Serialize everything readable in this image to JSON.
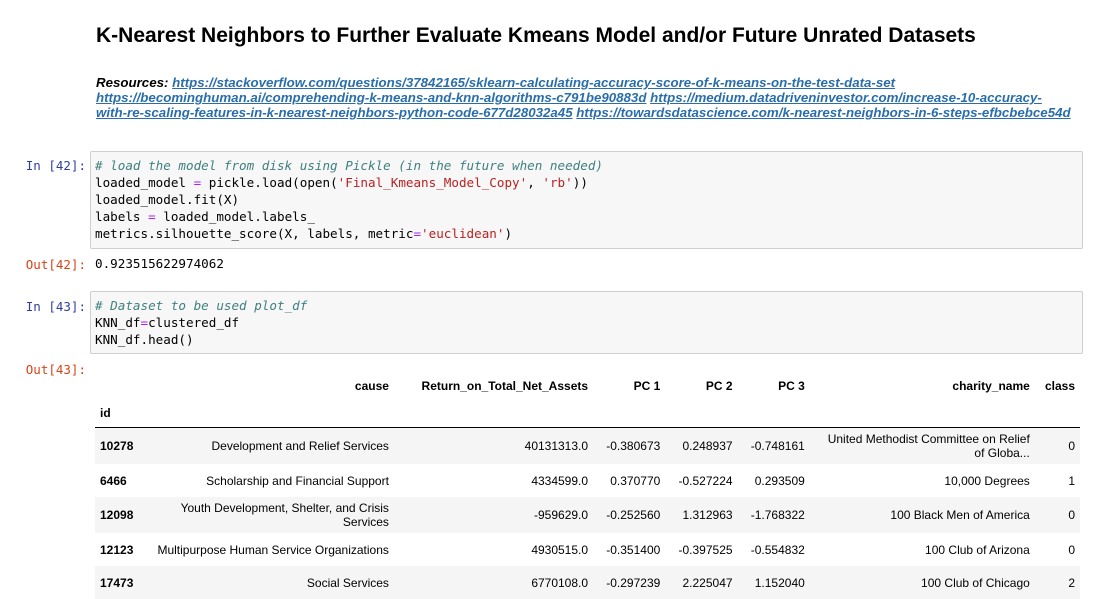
{
  "heading": "K-Nearest Neighbors to Further Evaluate Kmeans Model and/or Future Unrated Datasets",
  "resources": {
    "label": "Resources:",
    "links": [
      "https://stackoverflow.com/questions/37842165/sklearn-calculating-accuracy-score-of-k-means-on-the-test-data-set",
      "https://becominghuman.ai/comprehending-k-means-and-knn-algorithms-c791be90883d",
      "https://medium.datadriveninvestor.com/increase-10-accuracy-with-re-scaling-features-in-k-nearest-neighbors-python-code-677d28032a45",
      "https://towardsdatascience.com/k-nearest-neighbors-in-6-steps-efbcbebce54d"
    ]
  },
  "cell42": {
    "in_prompt": "In [42]:",
    "out_prompt": "Out[42]:",
    "output": "0.923515622974062",
    "lines": [
      [
        [
          "# load the model from disk using Pickle (in the future when needed)",
          "c"
        ]
      ],
      [
        [
          "loaded_model ",
          ""
        ],
        [
          "=",
          "o"
        ],
        [
          " pickle.load(open(",
          ""
        ],
        [
          "'Final_Kmeans_Model_Copy'",
          "s"
        ],
        [
          ", ",
          ""
        ],
        [
          "'rb'",
          "s"
        ],
        [
          "))",
          ""
        ]
      ],
      [
        [
          "loaded_model.fit(X)",
          ""
        ]
      ],
      [
        [
          "labels ",
          ""
        ],
        [
          "=",
          "o"
        ],
        [
          " loaded_model.labels_",
          ""
        ]
      ],
      [
        [
          "metrics.silhouette_score(X, labels, metric",
          ""
        ],
        [
          "=",
          "o"
        ],
        [
          "'euclidean'",
          "s"
        ],
        [
          ")",
          ""
        ]
      ]
    ]
  },
  "cell43": {
    "in_prompt": "In [43]:",
    "out_prompt": "Out[43]:",
    "lines": [
      [
        [
          "# Dataset to be used plot_df",
          "c"
        ]
      ],
      [
        [
          "KNN_df",
          ""
        ],
        [
          "=",
          "o"
        ],
        [
          "clustered_df",
          ""
        ]
      ],
      [
        [
          "KNN_df.head()",
          ""
        ]
      ]
    ]
  },
  "table": {
    "index_name": "id",
    "columns": [
      "cause",
      "Return_on_Total_Net_Assets",
      "PC 1",
      "PC 2",
      "PC 3",
      "charity_name",
      "class"
    ],
    "rows": [
      [
        "10278",
        "Development and Relief Services",
        "40131313.0",
        "-0.380673",
        "0.248937",
        "-0.748161",
        "United Methodist Committee on Relief of Globa...",
        "0"
      ],
      [
        "6466",
        "Scholarship and Financial Support",
        "4334599.0",
        "0.370770",
        "-0.527224",
        "0.293509",
        "10,000 Degrees",
        "1"
      ],
      [
        "12098",
        "Youth Development, Shelter, and Crisis Services",
        "-959629.0",
        "-0.252560",
        "1.312963",
        "-1.768322",
        "100 Black Men of America",
        "0"
      ],
      [
        "12123",
        "Multipurpose Human Service Organizations",
        "4930515.0",
        "-0.351400",
        "-0.397525",
        "-0.554832",
        "100 Club of Arizona",
        "0"
      ],
      [
        "17473",
        "Social Services",
        "6770108.0",
        "-0.297239",
        "2.225047",
        "1.152040",
        "100 Club of Chicago",
        "2"
      ]
    ]
  }
}
